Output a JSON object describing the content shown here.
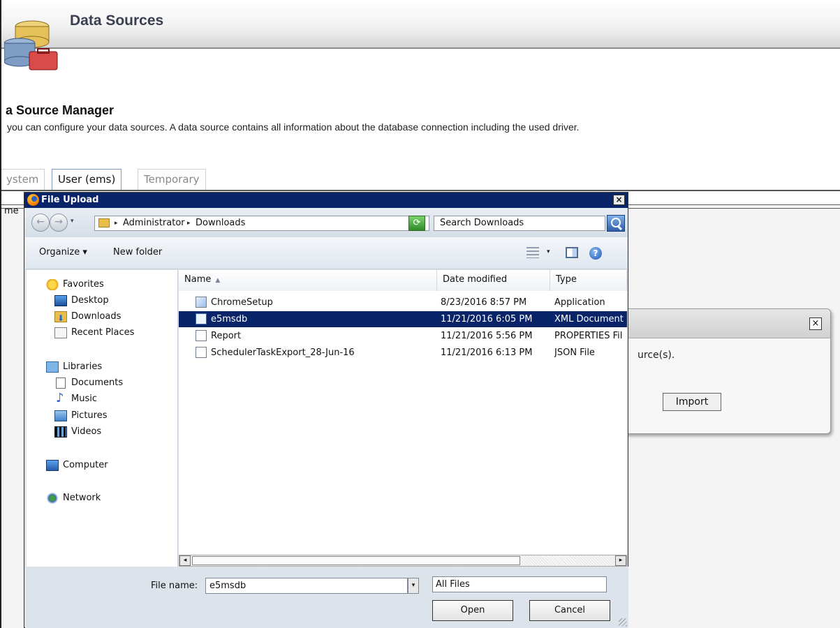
{
  "page": {
    "header_title": "Data Sources",
    "manager_title": "a Source Manager",
    "manager_desc": " you can configure your data sources. A data source contains all information about the database connection including the used driver.",
    "tabs": [
      {
        "label": "ystem",
        "active": false
      },
      {
        "label": "User (ems)",
        "active": true
      },
      {
        "label": "Temporary",
        "active": false
      }
    ],
    "table_col_fragment": "me"
  },
  "import_modal": {
    "close_label": "×",
    "text_fragment": "urce(s).",
    "import_button": "Import"
  },
  "dialog": {
    "title": "File Upload",
    "close_label": "×",
    "nav": {
      "back": "←",
      "forward": "→"
    },
    "address": {
      "crumbs": [
        "Administrator",
        "Downloads"
      ],
      "separator": "▸",
      "dropdown": "▾"
    },
    "search_placeholder": "Search Downloads",
    "toolbar": {
      "organize": "Organize ▾",
      "new_folder": "New folder",
      "view_dropdown": "▾",
      "help": "?"
    },
    "sidebar": [
      {
        "label": "Favorites",
        "icon": "star-icon",
        "group": true
      },
      {
        "label": "Desktop",
        "icon": "desktop-icon"
      },
      {
        "label": "Downloads",
        "icon": "downloads-icon"
      },
      {
        "label": "Recent Places",
        "icon": "recent-places-icon"
      },
      {
        "label": "Libraries",
        "icon": "libraries-icon",
        "group": true
      },
      {
        "label": "Documents",
        "icon": "documents-icon"
      },
      {
        "label": "Music",
        "icon": "music-icon"
      },
      {
        "label": "Pictures",
        "icon": "pictures-icon"
      },
      {
        "label": "Videos",
        "icon": "videos-icon"
      },
      {
        "label": "Computer",
        "icon": "computer-icon",
        "group": true
      },
      {
        "label": "Network",
        "icon": "network-icon",
        "group": true
      }
    ],
    "columns": {
      "name": "Name",
      "sort_indicator": "▲",
      "date": "Date modified",
      "type": "Type"
    },
    "files": [
      {
        "name": "ChromeSetup",
        "date": "8/23/2016 8:57 PM",
        "type": "Application",
        "icon": "application-icon",
        "selected": false
      },
      {
        "name": "e5msdb",
        "date": "11/21/2016 6:05 PM",
        "type": "XML Document",
        "icon": "xml-document-icon",
        "selected": true
      },
      {
        "name": "Report",
        "date": "11/21/2016 5:56 PM",
        "type": "PROPERTIES Fil",
        "icon": "file-icon",
        "selected": false
      },
      {
        "name": "SchedulerTaskExport_28-Jun-16",
        "date": "11/21/2016 6:13 PM",
        "type": "JSON File",
        "icon": "file-icon",
        "selected": false
      }
    ],
    "scroll": {
      "left": "◂",
      "right": "▸"
    },
    "file_name_label": "File name:",
    "file_name_value": "e5msdb",
    "file_type_value": "All Files",
    "dropdown_arrow": "▾",
    "open_button": "Open",
    "cancel_button": "Cancel"
  },
  "colors": {
    "titlebar": "#0a246a",
    "selection": "#0a246a",
    "dialog_bg": "#dde3ea"
  }
}
